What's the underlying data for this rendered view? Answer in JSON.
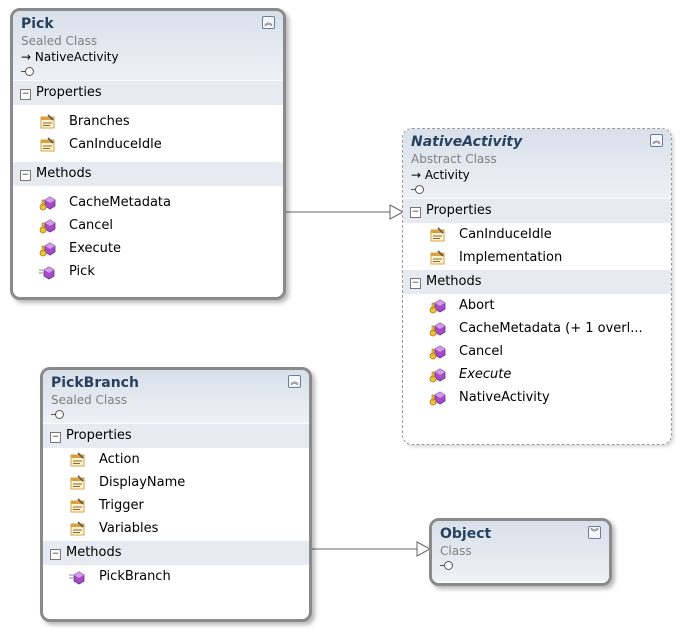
{
  "classes": {
    "pick": {
      "name": "Pick",
      "kind": "Sealed Class",
      "base": "→ NativeActivity",
      "properties_label": "Properties",
      "methods_label": "Methods",
      "properties": [
        "Branches",
        "CanInduceIdle"
      ],
      "methods": [
        "CacheMetadata",
        "Cancel",
        "Execute",
        "Pick"
      ]
    },
    "native_activity": {
      "name": "NativeActivity",
      "kind": "Abstract Class",
      "base": "→ Activity",
      "properties_label": "Properties",
      "methods_label": "Methods",
      "properties": [
        "CanInduceIdle",
        "Implementation"
      ],
      "methods": [
        "Abort",
        "CacheMetadata (+ 1 overl...",
        "Cancel",
        "Execute",
        "NativeActivity"
      ]
    },
    "pick_branch": {
      "name": "PickBranch",
      "kind": "Sealed Class",
      "properties_label": "Properties",
      "methods_label": "Methods",
      "properties": [
        "Action",
        "DisplayName",
        "Trigger",
        "Variables"
      ],
      "methods": [
        "PickBranch"
      ]
    },
    "object": {
      "name": "Object",
      "kind": "Class"
    }
  },
  "icons": {
    "property": "property-icon",
    "protected_method": "protected-method-icon",
    "public_method": "public-method-icon",
    "collapse": "collapse-chevron-up-icon",
    "expand": "expand-chevron-down-icon"
  },
  "colors": {
    "class_name": "#27425f",
    "header_bg": "#e3e8ef",
    "section_bg": "#e7ebf1",
    "method_icon": "#a44cc7",
    "property_icon": "#d9a13b",
    "border": "#8a8a8a"
  }
}
